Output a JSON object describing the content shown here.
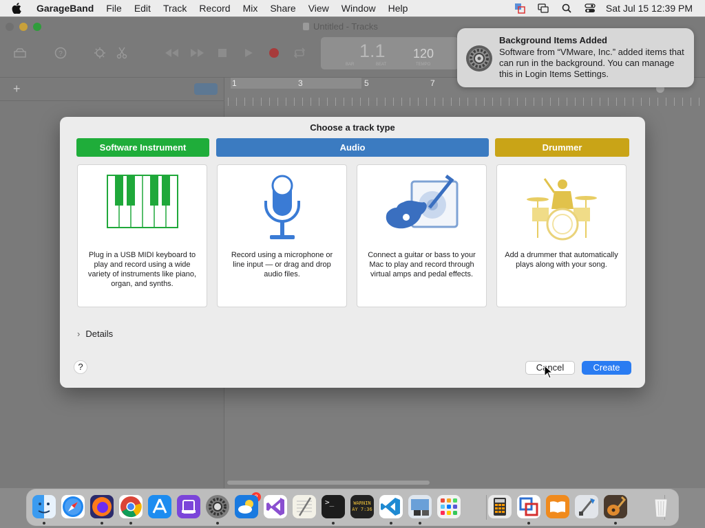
{
  "menubar": {
    "app_name": "GarageBand",
    "items": [
      "File",
      "Edit",
      "Track",
      "Record",
      "Mix",
      "Share",
      "View",
      "Window",
      "Help"
    ],
    "clock": "Sat Jul 15  12:39 PM"
  },
  "window": {
    "title": "Untitled - Tracks",
    "lcd": {
      "position": "1.1",
      "tempo": "120",
      "bar_label": "BAR",
      "beat_label": "BEAT",
      "tempo_label": "TEMPO"
    },
    "ruler": [
      "1",
      "3",
      "5",
      "7"
    ]
  },
  "notification": {
    "title": "Background Items Added",
    "body": "Software from “VMware, Inc.” added items that can run in the background. You can manage this in Login Items Settings."
  },
  "dialog": {
    "title": "Choose a track type",
    "categories": {
      "software_instrument": "Software Instrument",
      "audio": "Audio",
      "drummer": "Drummer"
    },
    "cards": {
      "midi": "Plug in a USB MIDI keyboard to play and record using a wide variety of instruments like piano, organ, and synths.",
      "mic": "Record using a microphone or line input — or drag and drop audio files.",
      "guitar": "Connect a guitar or bass to your Mac to play and record through virtual amps and pedal effects.",
      "drummer": "Add a drummer that automatically plays along with your song."
    },
    "details_label": "Details",
    "help_label": "?",
    "cancel_label": "Cancel",
    "create_label": "Create"
  },
  "dock": {
    "settings_badge": "2",
    "console_label": "WARNIN",
    "console_time": "AY 7:36"
  },
  "colors": {
    "software_instrument": "#1fad3a",
    "audio": "#3b7bc1",
    "drummer": "#c9a417",
    "create": "#2a7cf2"
  }
}
